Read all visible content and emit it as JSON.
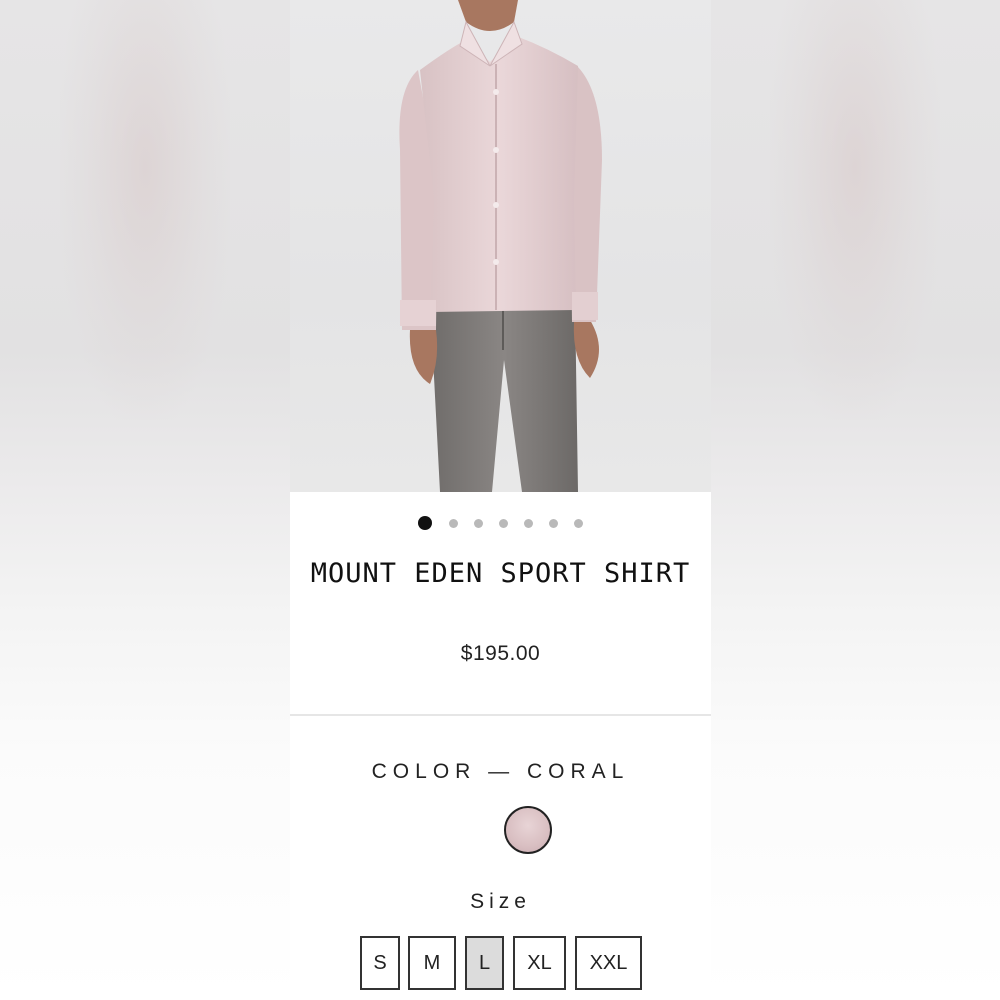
{
  "product": {
    "title": "MOUNT EDEN SPORT SHIRT",
    "price": "$195.00"
  },
  "gallery": {
    "image_count": 7,
    "active_index": 0
  },
  "color": {
    "label": "COLOR — CORAL",
    "swatch_name": "coral",
    "swatch_hex": "#d9bfc2"
  },
  "size": {
    "label": "Size",
    "options": [
      "S",
      "M",
      "L",
      "XL",
      "XXL"
    ],
    "selected": "L"
  },
  "colors": {
    "shirt": "#e3cfd1",
    "pants": "#7d7a78",
    "skin": "#a87760",
    "background": "#e7e7e8"
  }
}
